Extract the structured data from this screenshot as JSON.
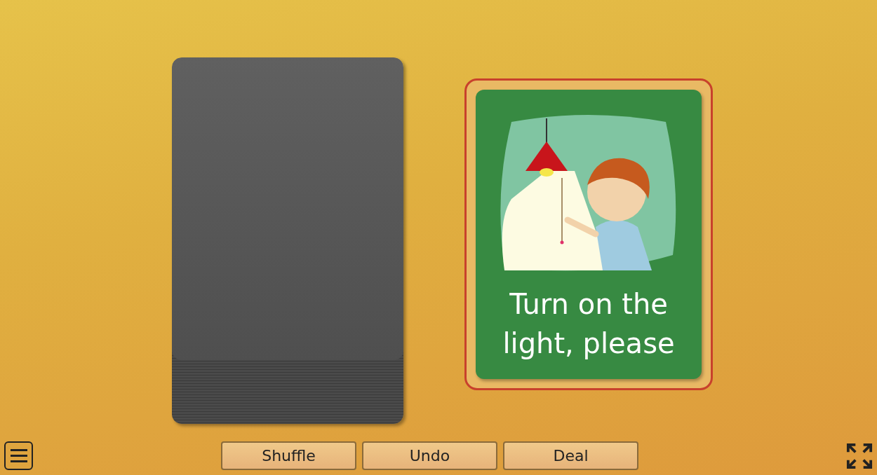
{
  "card": {
    "caption": "Turn on the light, please"
  },
  "buttons": [
    {
      "label": "Shuffle"
    },
    {
      "label": "Undo"
    },
    {
      "label": "Deal"
    }
  ]
}
